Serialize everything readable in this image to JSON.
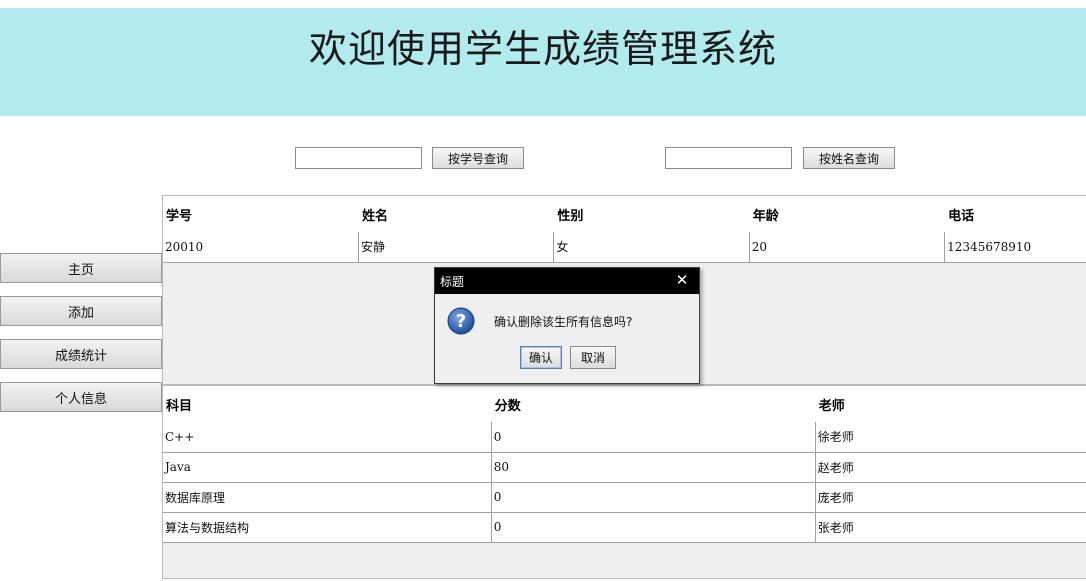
{
  "header": {
    "title": "欢迎使用学生成绩管理系统"
  },
  "search": {
    "id_input_value": "",
    "id_button_label": "按学号查询",
    "name_input_value": "",
    "name_button_label": "按姓名查询"
  },
  "nav": {
    "items": [
      {
        "label": "主页"
      },
      {
        "label": "添加"
      },
      {
        "label": "成绩统计"
      },
      {
        "label": "个人信息"
      }
    ]
  },
  "student_table": {
    "headers": [
      "学号",
      "姓名",
      "性别",
      "年龄",
      "电话"
    ],
    "rows": [
      [
        "20010",
        "安静",
        "女",
        "20",
        "12345678910"
      ]
    ]
  },
  "score_table": {
    "headers": [
      "科目",
      "分数",
      "老师"
    ],
    "rows": [
      [
        "C++",
        "0",
        "徐老师"
      ],
      [
        "Java",
        "80",
        "赵老师"
      ],
      [
        "数据库原理",
        "0",
        "庞老师"
      ],
      [
        "算法与数据结构",
        "0",
        "张老师"
      ]
    ]
  },
  "dialog": {
    "title": "标题",
    "message": "确认删除该生所有信息吗?",
    "confirm_label": "确认",
    "cancel_label": "取消",
    "icon": "question-icon",
    "icon_color": "#2b5fb4"
  },
  "colors": {
    "banner_bg": "#b2ebee",
    "dialog_titlebar": "#000000",
    "panel_bg": "#efefef"
  }
}
